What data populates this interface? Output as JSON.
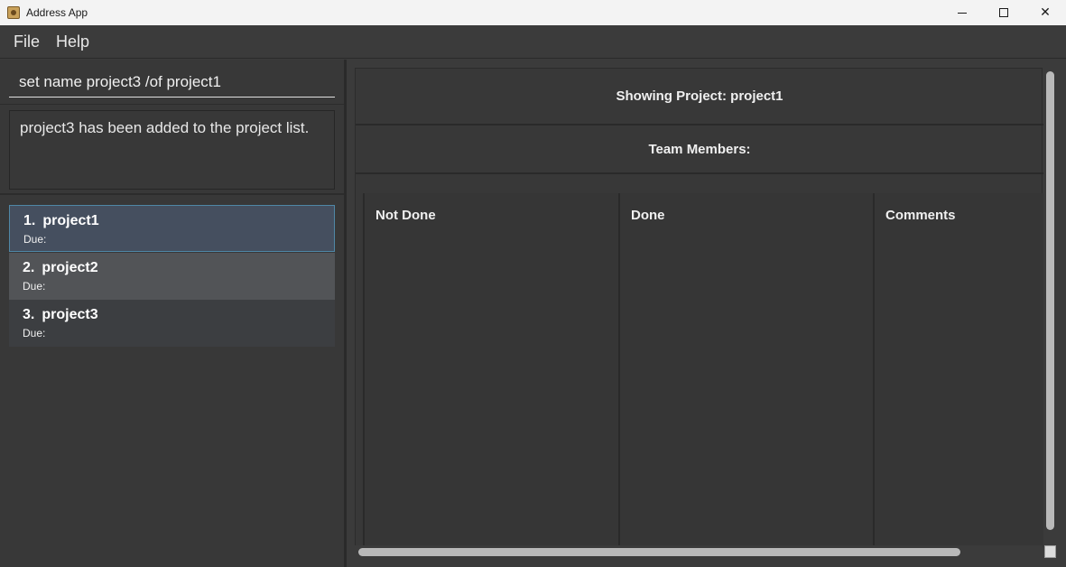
{
  "window": {
    "title": "Address App",
    "controls": {
      "minimize": "minimize",
      "maximize": "maximize",
      "close": "✕"
    }
  },
  "menu": {
    "items": [
      {
        "label": "File"
      },
      {
        "label": "Help"
      }
    ]
  },
  "command": {
    "value": "set name project3 /of project1"
  },
  "result": {
    "message": "project3 has been added to the project list."
  },
  "projects": [
    {
      "index": "1.",
      "name": "project1",
      "due": "Due:",
      "selected": true
    },
    {
      "index": "2.",
      "name": "project2",
      "due": "Due:",
      "selected": false
    },
    {
      "index": "3.",
      "name": "project3",
      "due": "Due:",
      "selected": false
    }
  ],
  "detail": {
    "showing": "Showing Project: project1",
    "team_members": "Team Members:",
    "columns": [
      {
        "label": "Not Done"
      },
      {
        "label": "Done"
      },
      {
        "label": "Comments"
      }
    ]
  },
  "colors": {
    "background": "#3b3b3b",
    "selected_card": "#454f5f",
    "selected_border": "#4f87a6",
    "titlebar": "#f3f3f3"
  },
  "icons": {
    "app": "address-book-icon",
    "minimize": "minimize-icon",
    "maximize": "maximize-icon",
    "close": "close-icon"
  }
}
